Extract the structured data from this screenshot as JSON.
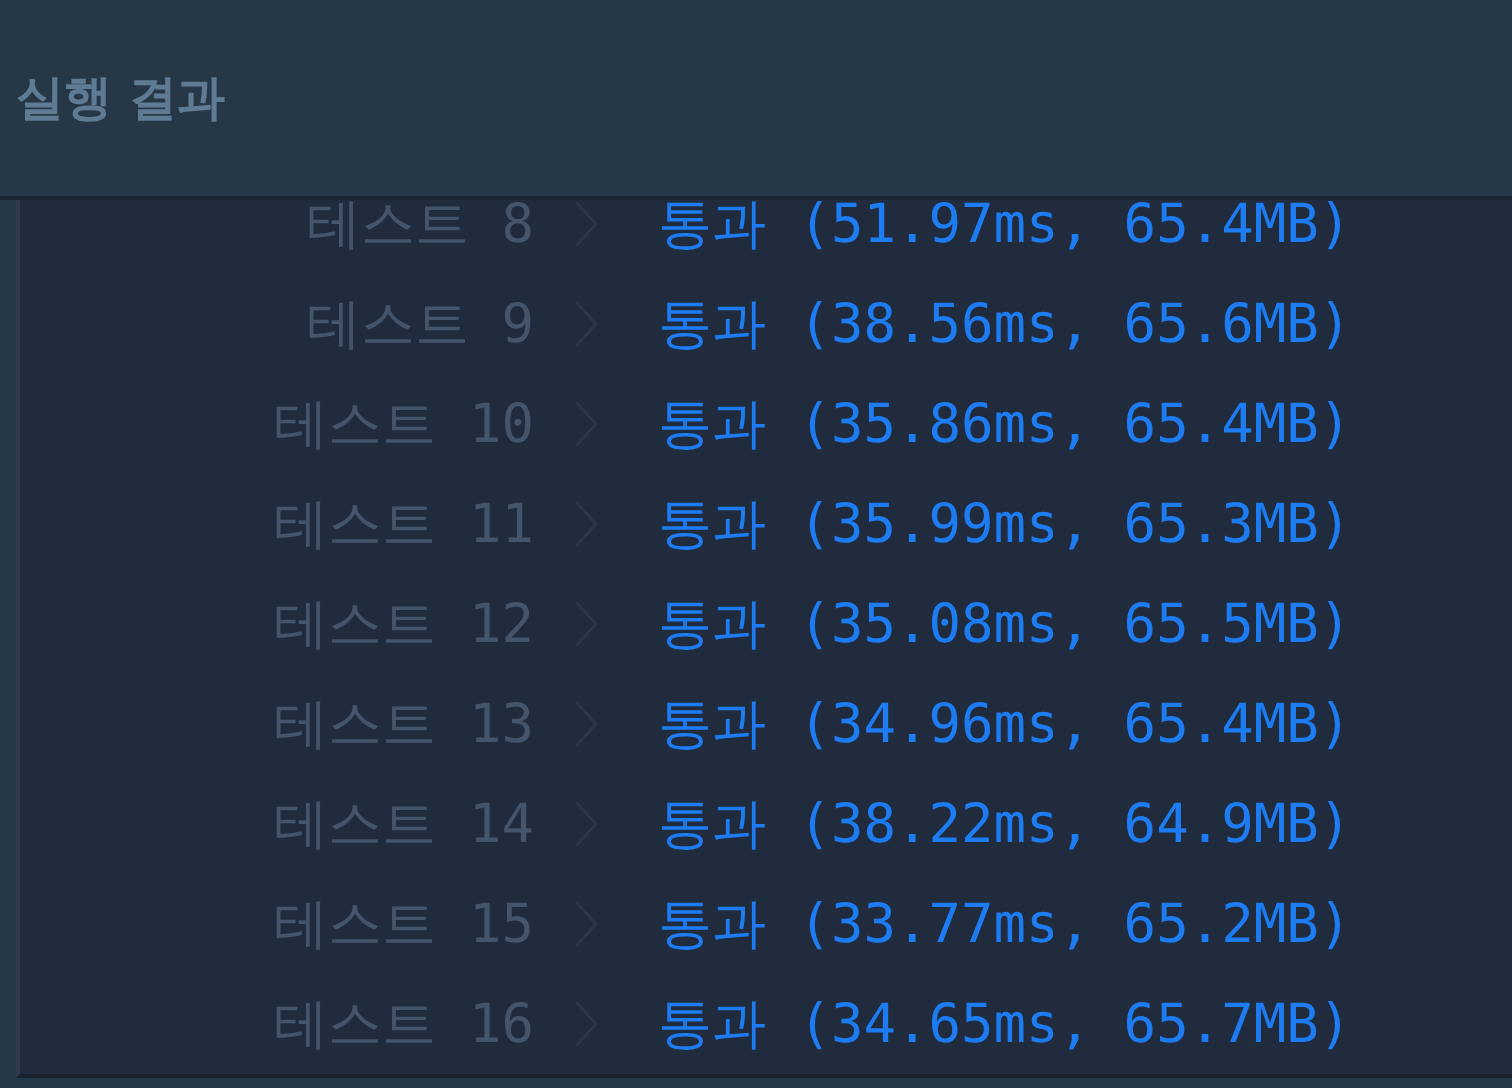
{
  "header": {
    "title": "실행 결과"
  },
  "results": [
    {
      "label": "테스트 8",
      "result": "통과 (51.97ms, 65.4MB)",
      "kind": "pass"
    },
    {
      "label": "테스트 9",
      "result": "통과 (38.56ms, 65.6MB)",
      "kind": "pass"
    },
    {
      "label": "테스트 10",
      "result": "통과 (35.86ms, 65.4MB)",
      "kind": "pass"
    },
    {
      "label": "테스트 11",
      "result": "통과 (35.99ms, 65.3MB)",
      "kind": "pass"
    },
    {
      "label": "테스트 12",
      "result": "통과 (35.08ms, 65.5MB)",
      "kind": "pass"
    },
    {
      "label": "테스트 13",
      "result": "통과 (34.96ms, 65.4MB)",
      "kind": "pass"
    },
    {
      "label": "테스트 14",
      "result": "통과 (38.22ms, 64.9MB)",
      "kind": "pass"
    },
    {
      "label": "테스트 15",
      "result": "통과 (33.77ms, 65.2MB)",
      "kind": "pass"
    },
    {
      "label": "테스트 16",
      "result": "통과 (34.65ms, 65.7MB)",
      "kind": "pass"
    }
  ]
}
